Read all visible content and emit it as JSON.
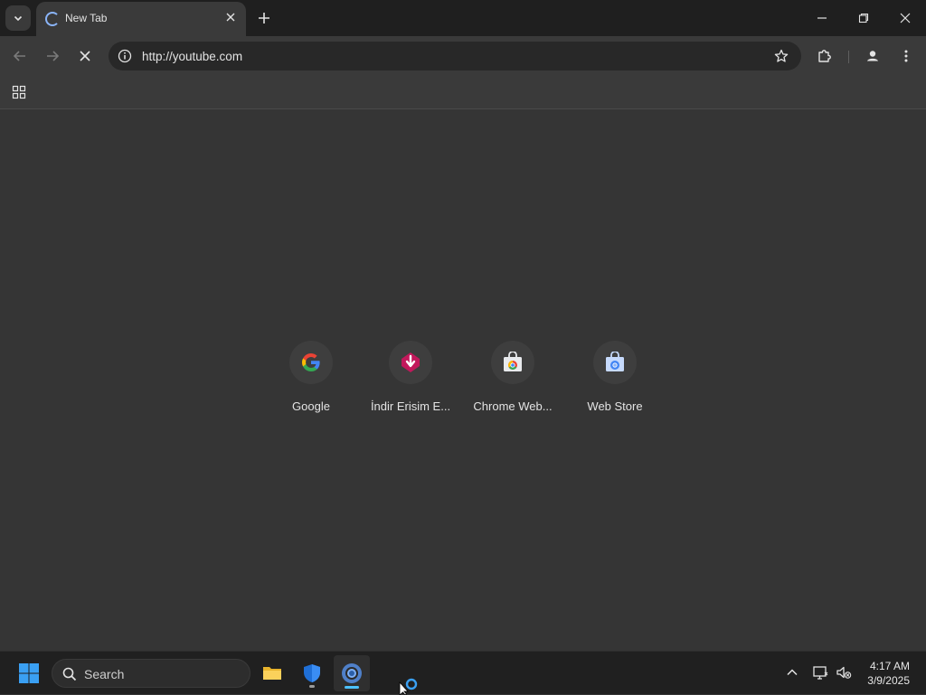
{
  "browser": {
    "tab": {
      "title": "New Tab"
    },
    "omnibox": {
      "url": "http://youtube.com"
    }
  },
  "shortcuts": [
    {
      "label": "Google",
      "icon": "google-icon"
    },
    {
      "label": "İndir Erisim E...",
      "icon": "download-icon"
    },
    {
      "label": "Chrome Web...",
      "icon": "chrome-web-store-icon"
    },
    {
      "label": "Web Store",
      "icon": "web-store-icon"
    }
  ],
  "taskbar": {
    "search_placeholder": "Search",
    "time": "4:17 AM",
    "date": "3/9/2025"
  },
  "colors": {
    "page_bg": "#353535",
    "toolbar_bg": "#3a3a3a",
    "tabstrip_bg": "#1f1f1f",
    "taskbar_bg": "#202020",
    "accent": "#4cc2ff"
  }
}
